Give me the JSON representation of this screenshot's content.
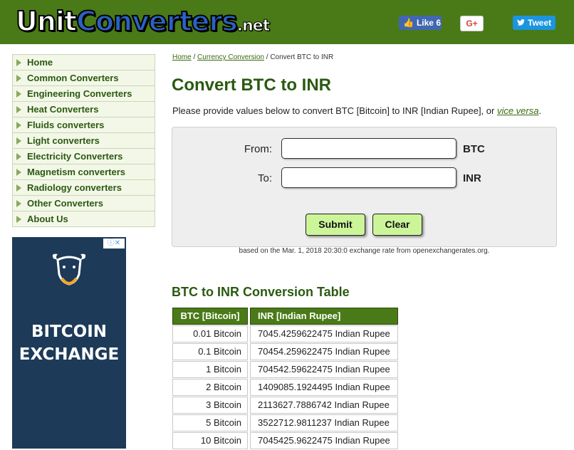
{
  "header": {
    "logo_part1": "Unit",
    "logo_part2": "Converters",
    "logo_part3": ".net",
    "like_label": "Like",
    "like_count": "6",
    "gplus_label": "G+",
    "tweet_label": "Tweet"
  },
  "nav": {
    "items": [
      "Home",
      "Common Converters",
      "Engineering Converters",
      "Heat Converters",
      "Fluids converters",
      "Light converters",
      "Electricity Converters",
      "Magnetism converters",
      "Radiology converters",
      "Other Converters",
      "About Us"
    ]
  },
  "ad": {
    "line1": "BITCOIN",
    "line2": "EXCHANGE"
  },
  "breadcrumb": {
    "home": "Home",
    "sep1": " / ",
    "currency": "Currency Conversion",
    "sep2": " / ",
    "current": "Convert BTC to INR"
  },
  "title": "Convert BTC to INR",
  "description": {
    "text": "Please provide values below to convert BTC [Bitcoin] to INR [Indian Rupee], or ",
    "link": "vice versa",
    "end": "."
  },
  "form": {
    "from_label": "From:",
    "from_unit": "BTC",
    "from_value": "",
    "to_label": "To:",
    "to_unit": "INR",
    "to_value": "",
    "submit_label": "Submit",
    "clear_label": "Clear"
  },
  "exchange_note": "based on the Mar. 1, 2018 20:30:0 exchange rate from openexchangerates.org.",
  "table": {
    "title": "BTC to INR Conversion Table",
    "col1": "BTC [Bitcoin]",
    "col2": "INR [Indian Rupee]",
    "rows": [
      [
        "0.01 Bitcoin",
        "7045.4259622475 Indian Rupee"
      ],
      [
        "0.1 Bitcoin",
        "70454.259622475 Indian Rupee"
      ],
      [
        "1 Bitcoin",
        "704542.59622475 Indian Rupee"
      ],
      [
        "2 Bitcoin",
        "1409085.1924495 Indian Rupee"
      ],
      [
        "3 Bitcoin",
        "2113627.7886742 Indian Rupee"
      ],
      [
        "5 Bitcoin",
        "3522712.9811237 Indian Rupee"
      ],
      [
        "10 Bitcoin",
        "7045425.9622475 Indian Rupee"
      ]
    ]
  },
  "colors": {
    "header_green": "#4a7a18",
    "title_green": "#2a5a10",
    "button_green": "#ccf59a"
  }
}
